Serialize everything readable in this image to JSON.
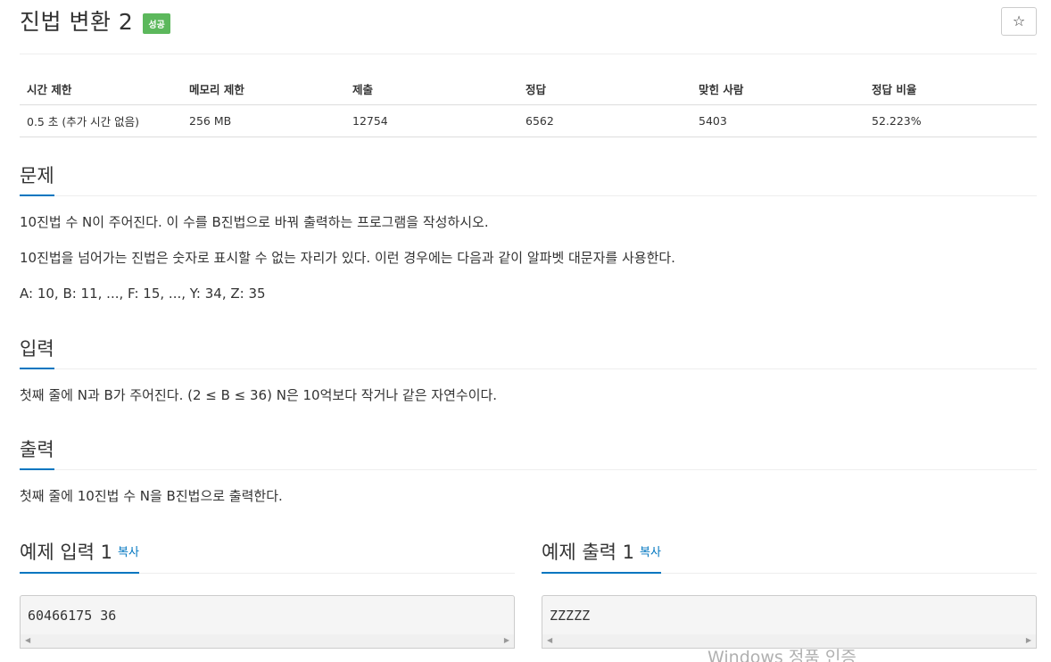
{
  "header": {
    "title": "진법 변환 2",
    "badge": "성공",
    "star_icon": "☆"
  },
  "info": {
    "columns": [
      "시간 제한",
      "메모리 제한",
      "제출",
      "정답",
      "맞힌 사람",
      "정답 비율"
    ],
    "values": [
      "0.5 초 (추가 시간 없음)",
      "256 MB",
      "12754",
      "6562",
      "5403",
      "52.223%"
    ]
  },
  "problem": {
    "title": "문제",
    "paragraphs": [
      "10진법 수 N이 주어진다. 이 수를 B진법으로 바꿔 출력하는 프로그램을 작성하시오.",
      "10진법을 넘어가는 진법은 숫자로 표시할 수 없는 자리가 있다. 이런 경우에는 다음과 같이 알파벳 대문자를 사용한다.",
      "A: 10, B: 11, ..., F: 15, ..., Y: 34, Z: 35"
    ]
  },
  "input": {
    "title": "입력",
    "text": "첫째 줄에 N과 B가 주어진다. (2 ≤ B ≤ 36) N은 10억보다 작거나 같은 자연수이다."
  },
  "output": {
    "title": "출력",
    "text": "첫째 줄에 10진법 수 N을 B진법으로 출력한다."
  },
  "sample_input": {
    "title": "예제 입력 1",
    "copy_label": "복사",
    "content": "60466175 36"
  },
  "sample_output": {
    "title": "예제 출력 1",
    "copy_label": "복사",
    "content": "ZZZZZ"
  },
  "watermark": "Windows 정품 인증",
  "colors": {
    "accent": "#0076c0",
    "badge_success": "#5cb85c"
  }
}
